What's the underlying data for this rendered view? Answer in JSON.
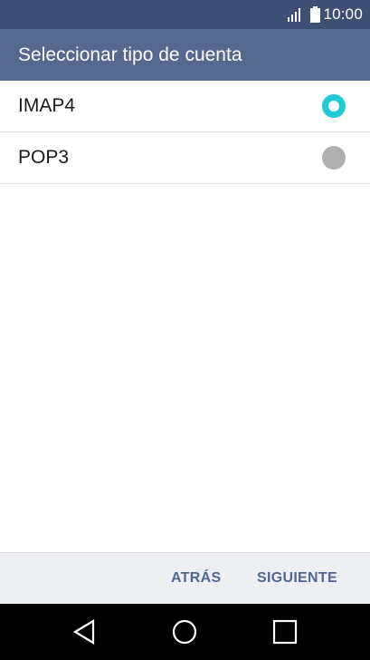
{
  "status_bar": {
    "time": "10:00",
    "icons": [
      "signal-icon",
      "battery-icon"
    ]
  },
  "app_bar": {
    "title": "Seleccionar tipo de cuenta"
  },
  "account_types": [
    {
      "label": "IMAP4",
      "selected": true
    },
    {
      "label": "POP3",
      "selected": false
    }
  ],
  "actions": {
    "back_label": "ATRÁS",
    "next_label": "SIGUIENTE"
  },
  "nav_bar": {
    "icons": [
      "back-icon",
      "home-icon",
      "recent-apps-icon"
    ]
  },
  "colors": {
    "status_bar": "#3d4f72",
    "app_bar": "#55698f",
    "radio_selected": "#20cbd4",
    "radio_unselected": "#b0b0b0",
    "action_text": "#4f6592",
    "action_bar": "#eeeff3",
    "nav_bar": "#000000"
  }
}
